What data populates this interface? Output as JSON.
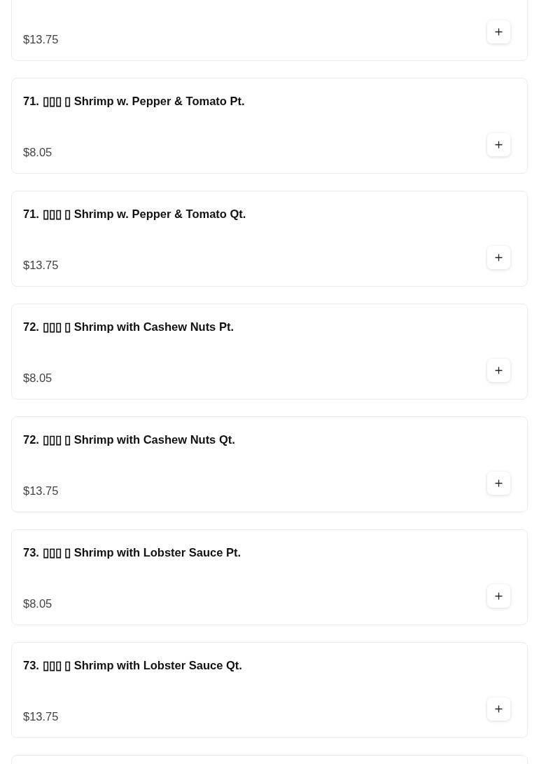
{
  "menu_items": [
    {
      "price": "$13.75"
    },
    {
      "title": "71. ▯▯▯ ▯ Shrimp w. Pepper & Tomato Pt.",
      "price": "$8.05"
    },
    {
      "title": "71. ▯▯▯ ▯ Shrimp w. Pepper & Tomato Qt.",
      "price": "$13.75"
    },
    {
      "title": "72. ▯▯▯ ▯ Shrimp with Cashew Nuts Pt.",
      "price": "$8.05"
    },
    {
      "title": "72. ▯▯▯ ▯ Shrimp with Cashew Nuts Qt.",
      "price": "$13.75"
    },
    {
      "title": "73. ▯▯▯ ▯ Shrimp with Lobster Sauce Pt.",
      "price": "$8.05"
    },
    {
      "title": "73. ▯▯▯ ▯ Shrimp with Lobster Sauce Qt.",
      "price": "$13.75"
    }
  ]
}
